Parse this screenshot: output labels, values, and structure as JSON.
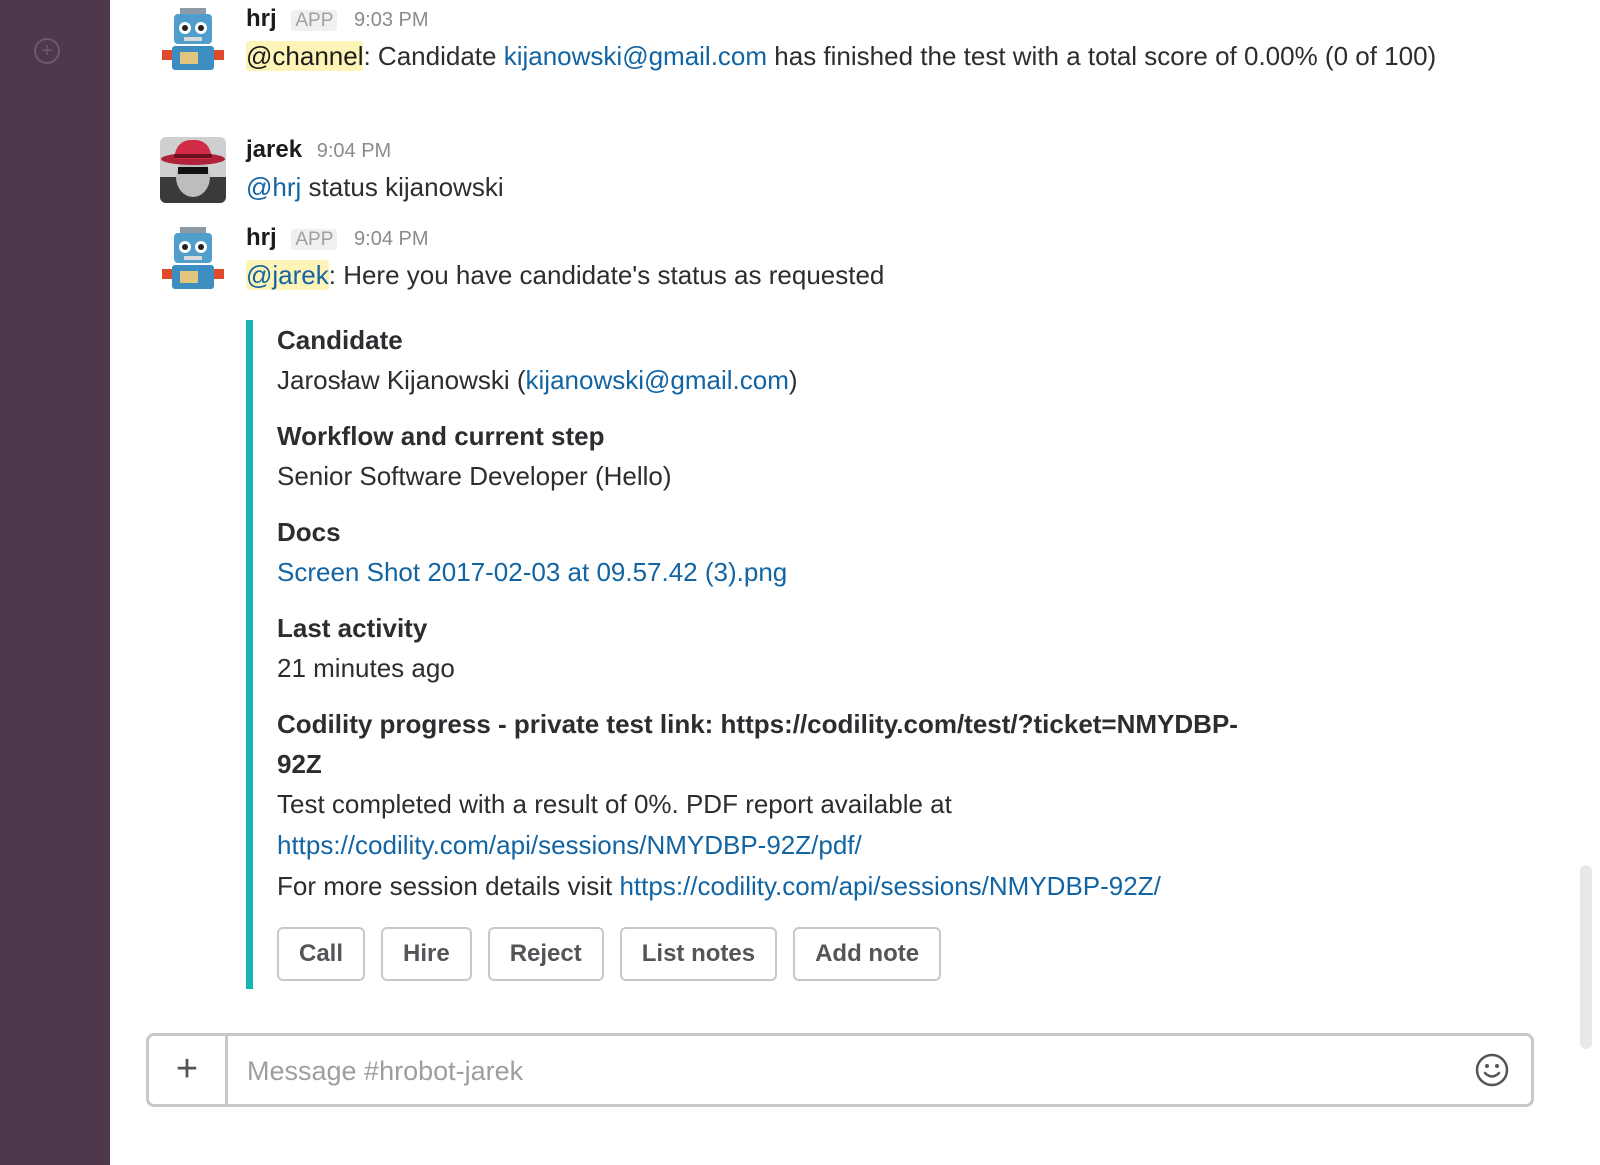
{
  "colors": {
    "sidebar": "#4d394b",
    "accent": "#17b5b2",
    "link": "#1264a3",
    "mention_bg": "#fff4b8"
  },
  "messages": [
    {
      "author": "hrj",
      "badge": "APP",
      "time": "9:03 PM",
      "mention": "@channel",
      "text_1": ": Candidate ",
      "email": "kijanowski@gmail.com",
      "text_2": " has finished the test with a total score of 0.00% (0 of 100)"
    },
    {
      "author": "jarek",
      "time": "9:04 PM",
      "mention": "@hrj",
      "text_1": " status kijanowski"
    },
    {
      "author": "hrj",
      "badge": "APP",
      "time": "9:04 PM",
      "mention": "@jarek",
      "text_1": ": Here you have candidate's status as requested"
    }
  ],
  "attachment": {
    "candidate": {
      "title": "Candidate",
      "name": "Jarosław Kijanowski (",
      "email": "kijanowski@gmail.com",
      "close": ")"
    },
    "workflow": {
      "title": "Workflow and current step",
      "value": "Senior Software Developer (Hello)"
    },
    "docs": {
      "title": "Docs",
      "file": "Screen Shot 2017-02-03 at 09.57.42 (3).png"
    },
    "activity": {
      "title": "Last activity",
      "value": "21 minutes ago"
    },
    "codility": {
      "title": "Codility progress - private test link: https://codility.com/test/?ticket=NMYDBP-92Z",
      "line1": "Test completed with a result of 0%. PDF report available at",
      "pdf_link": "https://codility.com/api/sessions/NMYDBP-92Z/pdf/",
      "line3": "For more session details visit ",
      "session_link": "https://codility.com/api/sessions/NMYDBP-92Z/"
    },
    "buttons": [
      "Call",
      "Hire",
      "Reject",
      "List notes",
      "Add note"
    ]
  },
  "composer": {
    "placeholder": "Message #hrobot-jarek",
    "add_icon": "plus-icon",
    "emoji_icon": "smiley-icon"
  },
  "sidebar": {
    "add_icon": "add-circle-icon"
  }
}
